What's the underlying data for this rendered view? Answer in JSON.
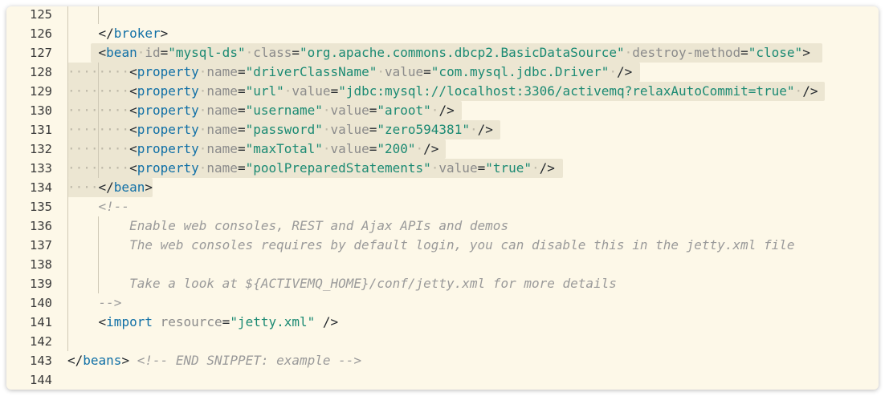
{
  "line_numbers": [
    "125",
    "126",
    "127",
    "128",
    "129",
    "130",
    "131",
    "132",
    "133",
    "134",
    "135",
    "136",
    "137",
    "138",
    "139",
    "140",
    "141",
    "142",
    "143",
    "144"
  ],
  "code": {
    "broker_close": "broker",
    "bean": {
      "tag": "bean",
      "id_attr": "id",
      "id_val": "\"mysql-ds\"",
      "class_attr": "class",
      "class_val": "\"org.apache.commons.dbcp2.BasicDataSource\"",
      "destroy_attr": "destroy-method",
      "destroy_val": "\"close\""
    },
    "property_tag": "property",
    "name_attr": "name",
    "value_attr": "value",
    "properties": [
      {
        "name": "\"driverClassName\"",
        "value": "\"com.mysql.jdbc.Driver\""
      },
      {
        "name": "\"url\"",
        "value": "\"jdbc:mysql://localhost:3306/activemq?relaxAutoCommit=true\""
      },
      {
        "name": "\"username\"",
        "value": "\"aroot\""
      },
      {
        "name": "\"password\"",
        "value": "\"zero594381\""
      },
      {
        "name": "\"maxTotal\"",
        "value": "\"200\""
      },
      {
        "name": "\"poolPreparedStatements\"",
        "value": "\"true\""
      }
    ],
    "bean_close": "bean",
    "comment_open": "<!--",
    "comment_lines": [
      "Enable web consoles, REST and Ajax APIs and demos",
      "The web consoles requires by default login, you can disable this in the jetty.xml file",
      "",
      "Take a look at ${ACTIVEMQ_HOME}/conf/jetty.xml for more details"
    ],
    "comment_close": "-->",
    "import": {
      "tag": "import",
      "attr": "resource",
      "val": "\"jetty.xml\""
    },
    "beans_close": "beans",
    "end_snippet": "<!-- END SNIPPET: example -->"
  }
}
